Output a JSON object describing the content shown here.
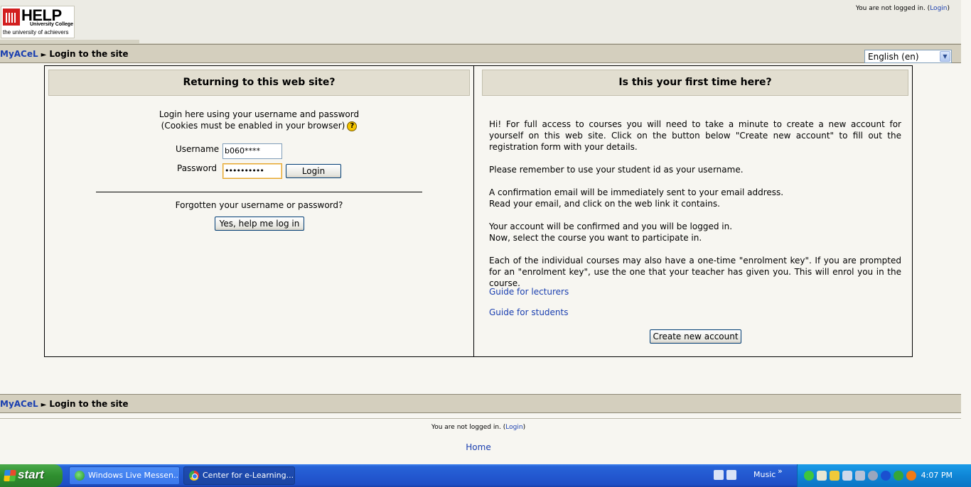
{
  "header": {
    "logo_text": "HELP",
    "logo_subtitle": "University College",
    "logo_tagline": "the university of achievers",
    "login_status_prefix": "You are not logged in. (",
    "login_link": "Login",
    "login_status_suffix": ")"
  },
  "breadcrumb": {
    "home": "MyACeL",
    "separator": "►",
    "current": "Login to the site"
  },
  "language_select": {
    "value": "English (en)"
  },
  "returning": {
    "heading": "Returning to this web site?",
    "intro_line1": "Login here using your username and password",
    "intro_line2": "(Cookies must be enabled in your browser)",
    "username_label": "Username",
    "username_value": "b060****",
    "password_label": "Password",
    "password_value": "••••••••••",
    "login_button": "Login",
    "forgot_text": "Forgotten your username or password?",
    "forgot_button": "Yes, help me log in"
  },
  "first_time": {
    "heading": "Is this your first time here?",
    "p1": "Hi! For full access to courses you will need to take a minute to create a new account for yourself on this web site. Click on the button below \"Create new account\" to fill out the registration form with your details.",
    "p2": "Please remember to use your student id as your username.",
    "p3a": "A confirmation email will be immediately sent to your email address.",
    "p3b": "Read your email, and click on the web link it contains.",
    "p4a": "Your account will be confirmed and you will be logged in.",
    "p4b": "Now, select the course you want to participate in.",
    "p5": "Each of the individual courses may also have a one-time \"enrolment key\". If you are prompted for an \"enrolment key\", use the one that your teacher has given you. This will enrol you in the course.",
    "guide_lecturers": "Guide for lecturers",
    "guide_students": "Guide for students",
    "create_button": "Create new account"
  },
  "footer": {
    "login_status_prefix": "You are not logged in. (",
    "login_link": "Login",
    "login_status_suffix": ")",
    "home_link": "Home"
  },
  "taskbar": {
    "start_label": "start",
    "tasks": [
      {
        "label": "Windows Live Messen...",
        "icon": "messenger-icon"
      },
      {
        "label": "Center for e-Learning...",
        "icon": "chrome-icon"
      }
    ],
    "toolbar_label": "Music",
    "toolbar_arrows": "»",
    "clock": "4:07 PM"
  },
  "colors": {
    "navbar": "#d4cfbe",
    "link": "#1a3fb0",
    "taskbar": "#2358d0",
    "start": "#2f8f2f"
  }
}
